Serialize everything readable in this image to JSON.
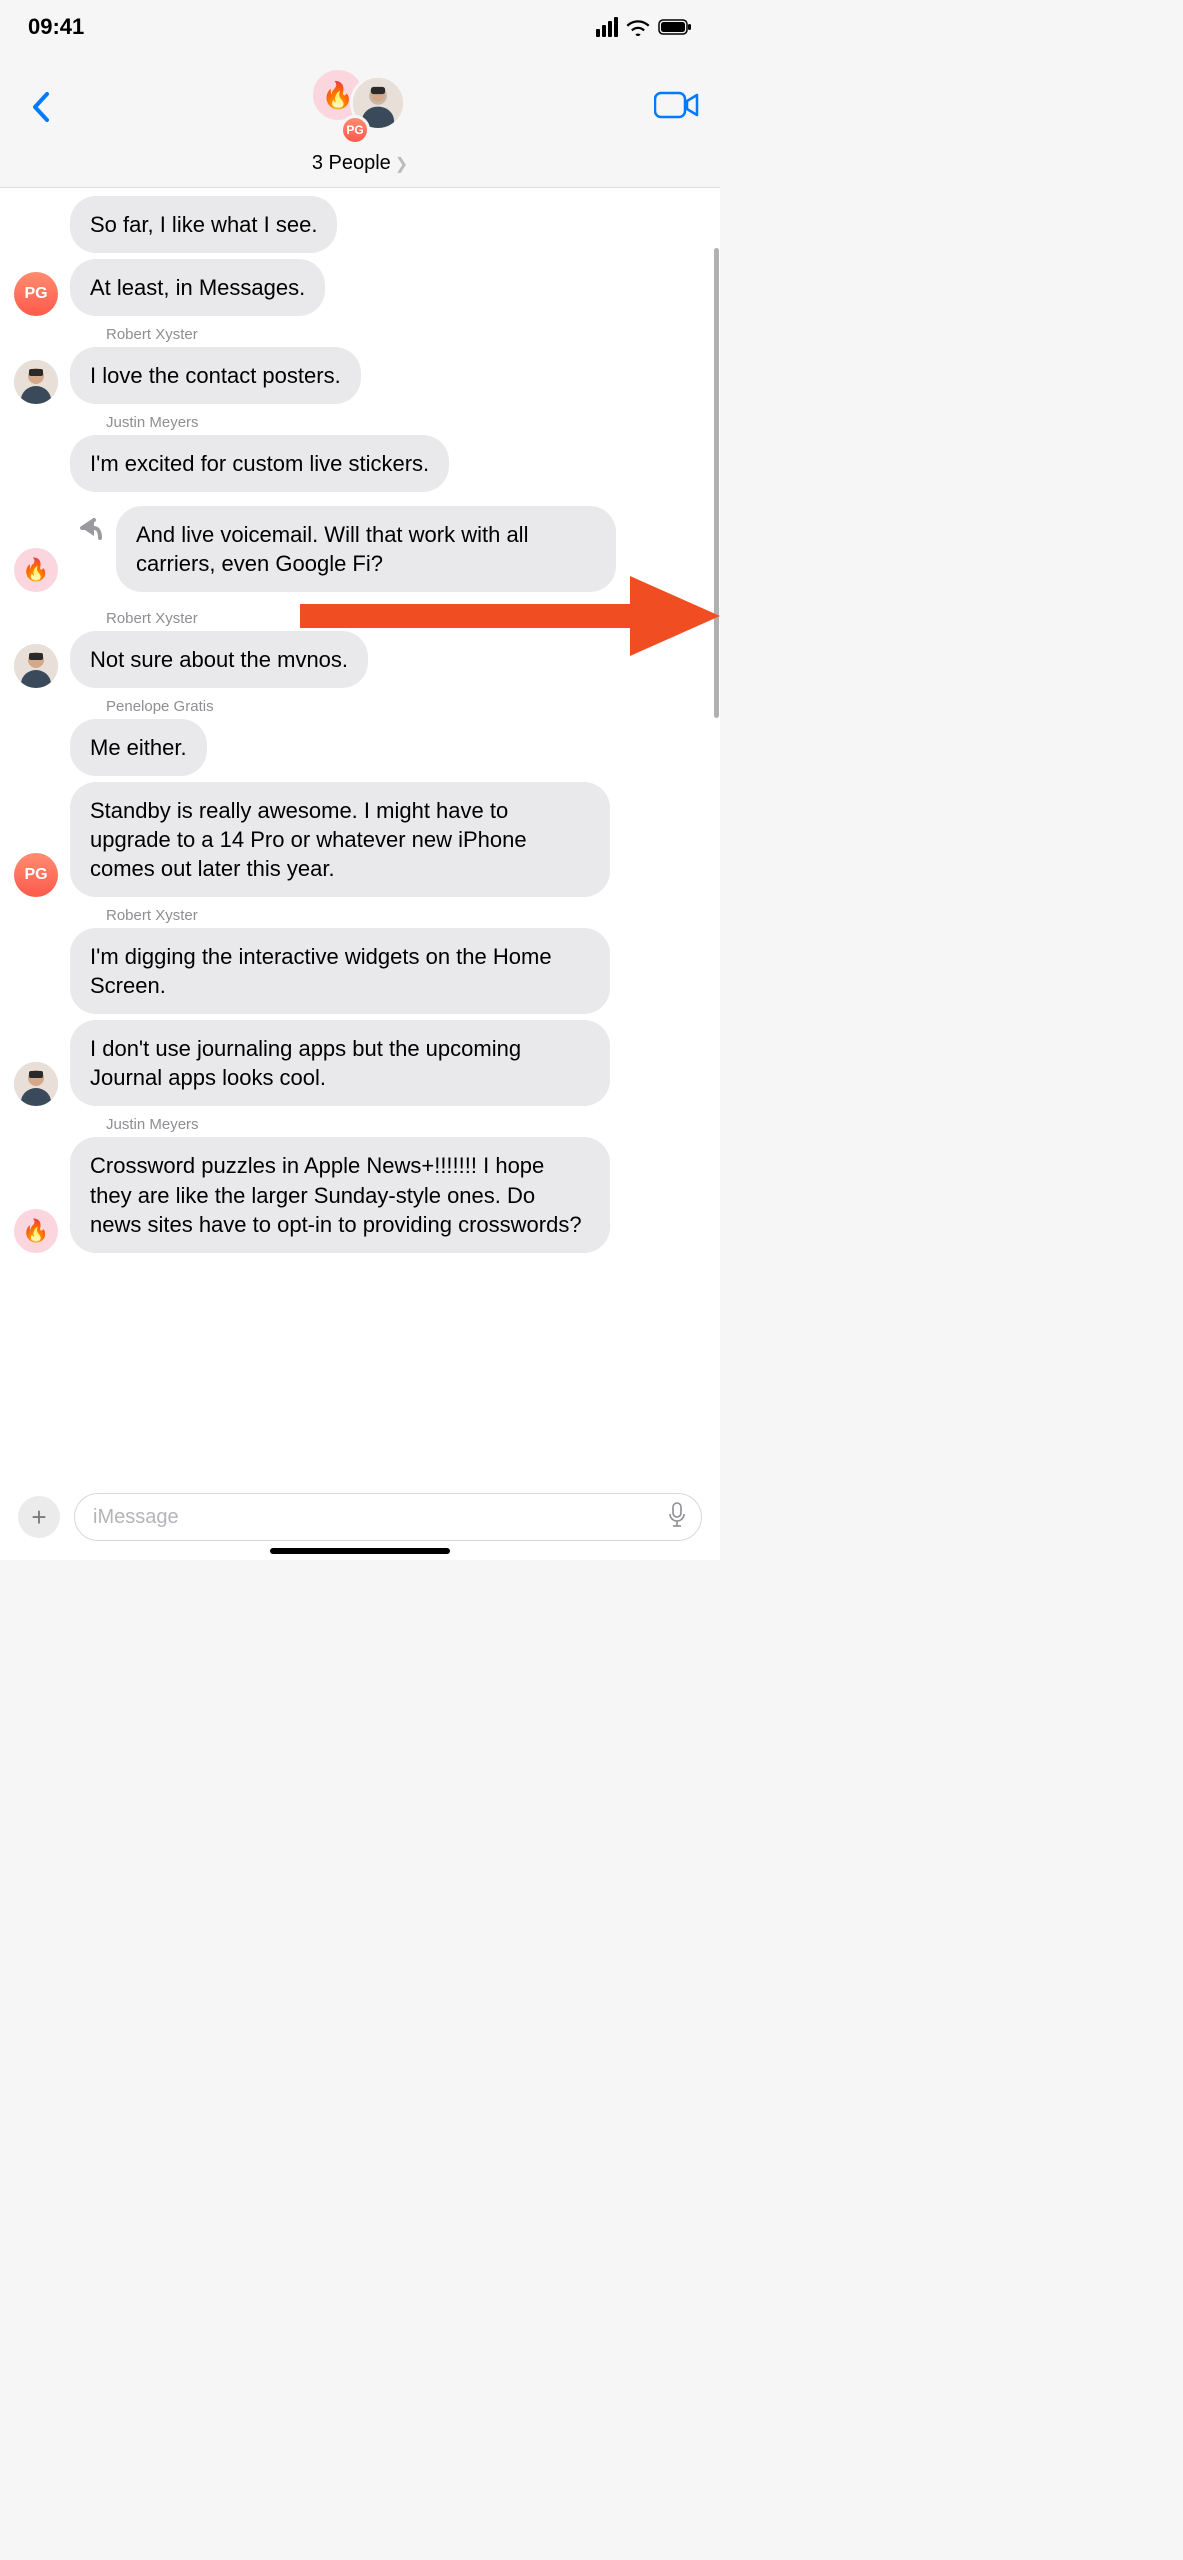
{
  "status": {
    "time": "09:41"
  },
  "header": {
    "subtitle": "3 People",
    "pg_initials": "PG"
  },
  "composer": {
    "placeholder": "iMessage"
  },
  "senders": {
    "robert": "Robert Xyster",
    "justin": "Justin Meyers",
    "penelope": "Penelope Gratis"
  },
  "avatars": {
    "pg": "PG",
    "fire": "🔥"
  },
  "messages": {
    "m1": "So far, I like what I see.",
    "m2": "At least, in Messages.",
    "m3": "I love the contact posters.",
    "m4": "I'm excited for custom live stickers.",
    "m5": "And live voicemail. Will that work with all carriers, even Google Fi?",
    "m6": "Not sure about the mvnos.",
    "m7": "Me either.",
    "m8": "Standby is really awesome. I might have to upgrade to a 14 Pro or whatever new iPhone comes out later this year.",
    "m9": "I'm digging the interactive widgets on the Home Screen.",
    "m10": "I don't use journaling apps but the upcoming Journal apps looks cool.",
    "m11": "Crossword puzzles in Apple News+!!!!!!! I hope they are like the larger Sunday-style ones. Do news sites have to opt-in to providing crosswords?"
  }
}
